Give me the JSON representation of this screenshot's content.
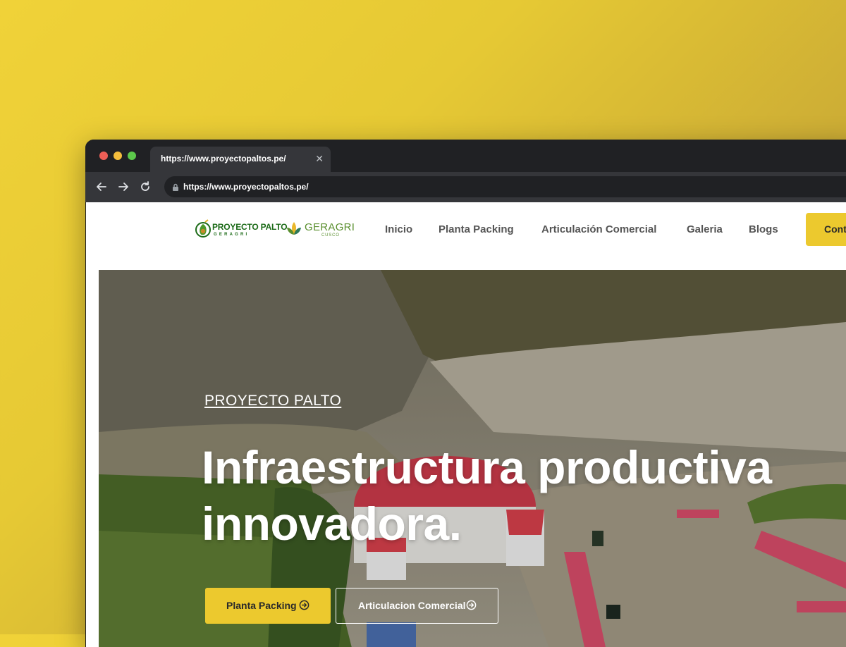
{
  "browser": {
    "tab_title": "https://www.proyectopaltos.pe/",
    "url": "https://www.proyectopaltos.pe/"
  },
  "header": {
    "logo_primary": {
      "name": "PROYECTO PALTO",
      "sub": "GERAGRI"
    },
    "logo_secondary": {
      "name": "GERAGRI",
      "sub": "CUSCO"
    },
    "nav": [
      "Inicio",
      "Planta Packing",
      "Articulación Comercial",
      "Galeria",
      "Blogs"
    ],
    "cta_label": "Cont"
  },
  "hero": {
    "eyebrow": "PROYECTO PALTO",
    "headline_line1": "Infraestructura productiva",
    "headline_line2": "innovadora.",
    "primary_button": "Planta Packing",
    "secondary_button": "Articulacion Comercial"
  },
  "colors": {
    "accent": "#ecc92e",
    "logo_green": "#1c6b18",
    "browser_dark": "#202124"
  },
  "icons": [
    "back-arrow-icon",
    "forward-arrow-icon",
    "reload-icon",
    "lock-icon",
    "close-icon",
    "arrow-circle-right-icon"
  ]
}
